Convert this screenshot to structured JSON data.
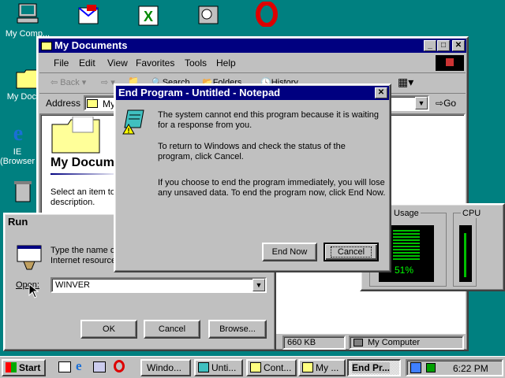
{
  "desktop": {
    "icons": [
      {
        "label": "My Comp..."
      },
      {
        "label": "My Docu..."
      },
      {
        "label": "IE (Browser)"
      }
    ]
  },
  "explorer": {
    "title": "My Documents",
    "menu": [
      "File",
      "Edit",
      "View",
      "Favorites",
      "Tools",
      "Help"
    ],
    "toolbar": {
      "back": "Back",
      "search": "Search",
      "folders": "Folders",
      "history": "History"
    },
    "address_label": "Address",
    "address_value": "My",
    "go_label": "Go",
    "folder_heading": "My Docum",
    "folder_hint": "Select an item to description.",
    "status_size": "660 KB",
    "status_location": "My Computer"
  },
  "sysmon": {
    "usage_label": "U Usage",
    "usage_value": "51%",
    "cpu_label": "CPU"
  },
  "run": {
    "title": "Run",
    "prompt": "Type the name o Internet resource",
    "open_label": "Open:",
    "open_value": "WINVER",
    "ok": "OK",
    "cancel": "Cancel",
    "browse": "Browse..."
  },
  "endprogram": {
    "title": "End Program - Untitled - Notepad",
    "para1": "The system cannot end this program because it is waiting for a response from you.",
    "para2": "To return to Windows and check the status of the program, click Cancel.",
    "para3": "If you choose to end the program immediately, you will lose any unsaved data. To end the program now, click End Now.",
    "end_now": "End Now",
    "cancel": "Cancel"
  },
  "taskbar": {
    "start": "Start",
    "tasks": [
      "Windo...",
      "Unti...",
      "Cont...",
      "My ...",
      "End Pr..."
    ],
    "clock": "6:22 PM"
  }
}
